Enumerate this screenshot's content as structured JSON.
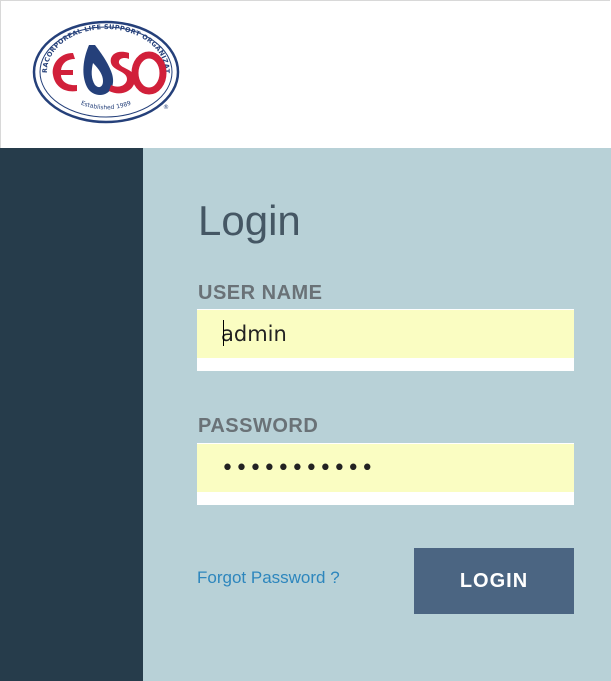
{
  "logo": {
    "text": "ELSO",
    "ring_text": "EXTRACORPOREAL LIFE SUPPORT ORGANIZATION",
    "established": "Established 1989",
    "trademark": "®"
  },
  "login": {
    "title": "Login",
    "username_label": "USER NAME",
    "username_value": "admin",
    "password_label": "PASSWORD",
    "password_value": "•••••••••••",
    "forgot_label": "Forgot Password ?",
    "submit_label": "LOGIN"
  },
  "colors": {
    "sidebar": "#263c4b",
    "panel": "#b8d1d7",
    "input_autofill": "#fafdc2",
    "button": "#4b6582",
    "link": "#2d86bd"
  }
}
